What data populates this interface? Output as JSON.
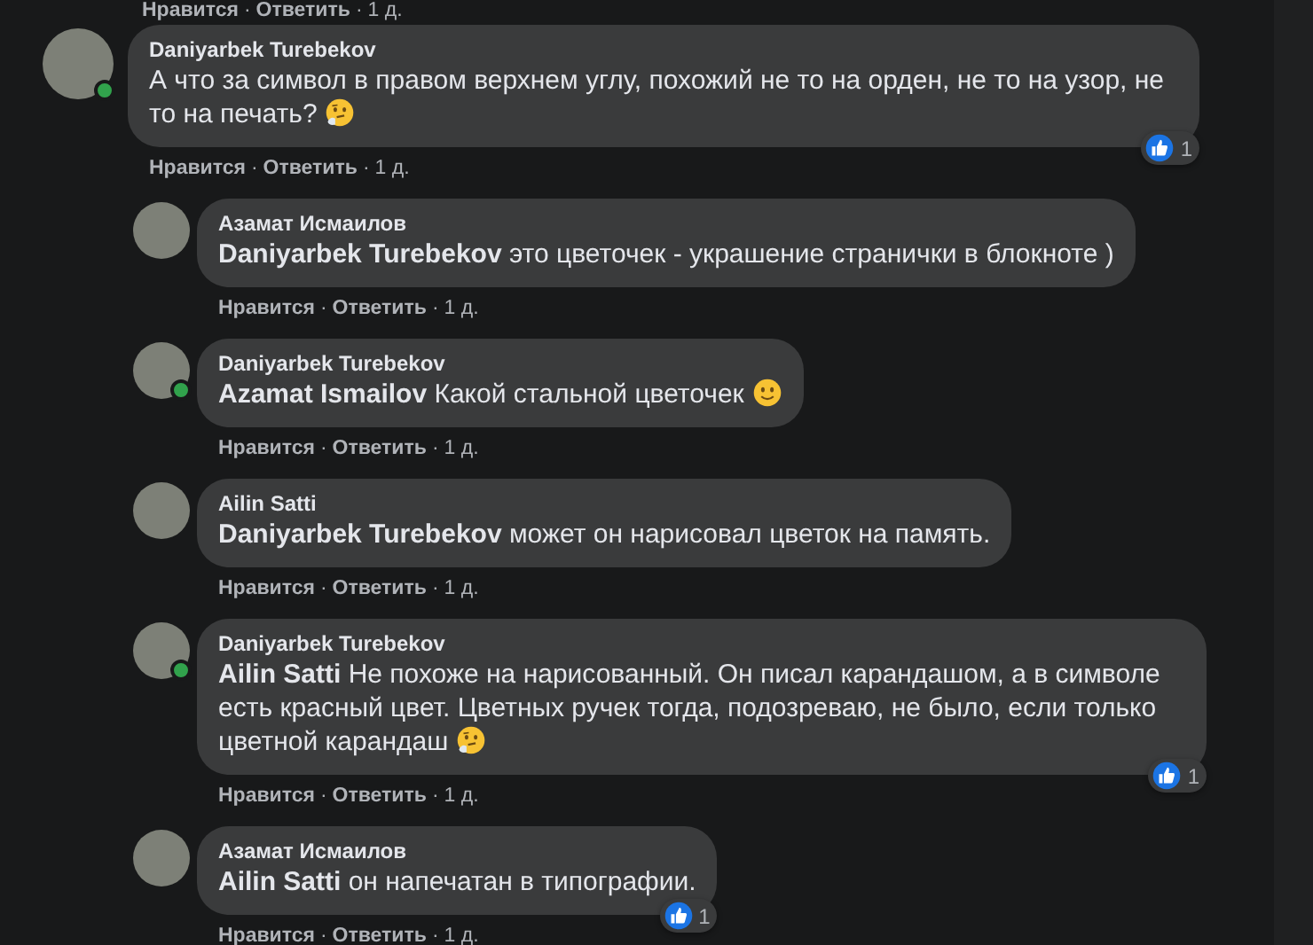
{
  "previous_actions": {
    "like": "Нравится",
    "sep": "·",
    "reply": "Ответить",
    "time": "1 д."
  },
  "comments": [
    {
      "author": "Daniyarbek Turebekov",
      "online": true,
      "text": "А что за символ в правом верхнем углу, похожий не то на орден, не то на узор, не то на печать?",
      "emoji": {
        "kind": "thinking"
      },
      "reactions": "1",
      "actions": {
        "like": "Нравится",
        "sep": "·",
        "reply": "Ответить",
        "time": "1 д."
      },
      "replies": [
        {
          "author": "Азамат Исмаилов",
          "online": false,
          "text": "**Daniyarbek Turebekov** это цветочек - украшение странички в блокноте )",
          "actions": {
            "like": "Нравится",
            "sep": "·",
            "reply": "Ответить",
            "time": "1 д."
          }
        },
        {
          "author": "Daniyarbek Turebekov",
          "online": true,
          "text": "**Azamat Ismailov** Какой стальной цветочек",
          "emoji": {
            "kind": "smile"
          },
          "actions": {
            "like": "Нравится",
            "sep": "·",
            "reply": "Ответить",
            "time": "1 д."
          }
        },
        {
          "author": "Ailin Satti",
          "online": false,
          "text": "**Daniyarbek Turebekov** может он нарисовал цветок на память.",
          "actions": {
            "like": "Нравится",
            "sep": "·",
            "reply": "Ответить",
            "time": "1 д."
          }
        },
        {
          "author": "Daniyarbek Turebekov",
          "online": true,
          "text": "**Ailin Satti** Не похоже на нарисованный. Он писал карандашом, а в символе есть красный цвет. Цветных ручек тогда, подозреваю, не было, если только цветной карандаш",
          "emoji": {
            "kind": "thinking"
          },
          "reactions": "1",
          "actions": {
            "like": "Нравится",
            "sep": "·",
            "reply": "Ответить",
            "time": "1 д."
          }
        },
        {
          "author": "Азамат Исмаилов",
          "online": false,
          "text": "**Ailin Satti** он напечатан в типографии.",
          "reactions": "1",
          "actions": {
            "like": "Нравится",
            "sep": "·",
            "reply": "Ответить",
            "time": "1 д."
          }
        }
      ]
    }
  ]
}
